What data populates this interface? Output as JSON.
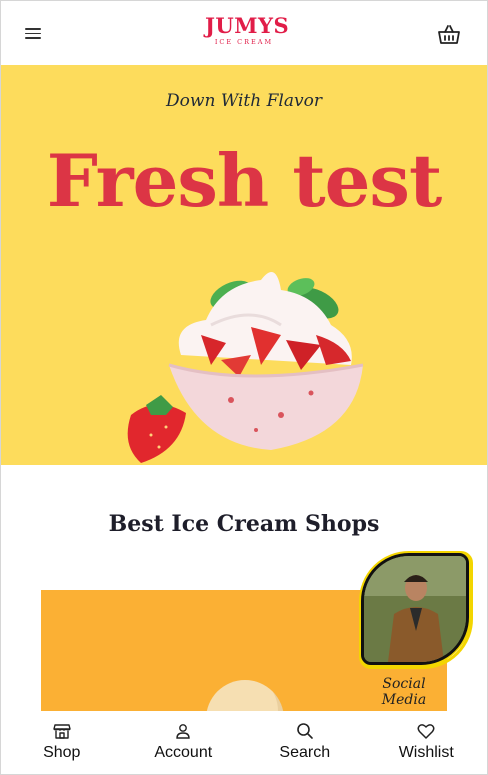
{
  "header": {
    "logo_main": "JUMYS",
    "logo_sub": "ICE CREAM",
    "menu_icon": "hamburger-menu-icon",
    "cart_icon": "shopping-basket-icon"
  },
  "hero": {
    "tagline": "Down With Flavor",
    "title": "Fresh test",
    "background": "#fddc5c",
    "title_color": "#dc3545"
  },
  "section": {
    "title": "Best Ice Cream Shops",
    "card_color": "#fbb034"
  },
  "social": {
    "label": "Social Media"
  },
  "bottom_nav": {
    "items": [
      {
        "label": "Shop",
        "icon": "store-icon"
      },
      {
        "label": "Account",
        "icon": "user-icon"
      },
      {
        "label": "Search",
        "icon": "search-icon"
      },
      {
        "label": "Wishlist",
        "icon": "heart-icon"
      }
    ]
  }
}
